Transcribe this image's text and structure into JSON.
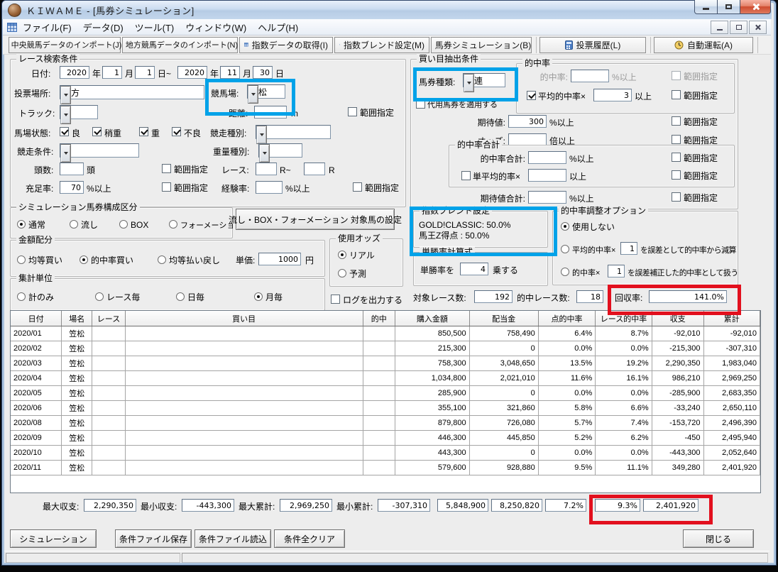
{
  "window": {
    "title": "ＫＩＷＡＭＥ - [馬券シミュレーション]",
    "menu": [
      "ファイル(F)",
      "データ(D)",
      "ツール(T)",
      "ウィンドウ(W)",
      "ヘルプ(H)"
    ]
  },
  "toolbar": {
    "buttons": [
      "中央競馬データのインポート(J)",
      "地方競馬データのインポート(N)",
      "指数データの取得(I)",
      "指数ブレンド設定(M)",
      "馬券シミュレーション(B)",
      "投票履歴(L)",
      "自動運転(A)"
    ]
  },
  "search": {
    "title": "レース検索条件",
    "date_label": "日付:",
    "y1": "2020",
    "m1": "1",
    "d1": "1",
    "y2": "2020",
    "m2": "11",
    "d2": "30",
    "year": "年",
    "month": "月",
    "day": "日",
    "day_tilde": "日~",
    "place_label": "投票場所:",
    "place_value": "地方",
    "course_label": "競馬場:",
    "course_value": "笠松",
    "track_label": "トラック:",
    "distance_label": "距離:",
    "distance_unit": "m",
    "range": "範囲指定",
    "cond_label": "馬場状態:",
    "cond_items": [
      "良",
      "稍重",
      "重",
      "不良"
    ],
    "race_type_label": "競走種別:",
    "race_cond_label": "競走条件:",
    "weight_label": "重量種別:",
    "heads_label": "頭数:",
    "heads_unit": "頭",
    "race_label": "レース:",
    "race_r1": "R~",
    "race_r2": "R",
    "full_label": "充足率:",
    "full_value": "70",
    "pct_min": "%以上",
    "exp_label": "経験率:"
  },
  "ticket": {
    "title": "シミュレーション馬券構成区分",
    "options": [
      "通常",
      "流し",
      "BOX",
      "フォーメーション"
    ],
    "selected": "通常",
    "setting_button": "流し・BOX・フォーメーション 対象馬の設定"
  },
  "amount": {
    "title": "金額配分",
    "options": [
      "均等買い",
      "的中率買い",
      "均等払い戻し"
    ],
    "selected": "的中率買い",
    "unit_label": "単価:",
    "unit_value": "1000",
    "yen": "円"
  },
  "odds_use": {
    "title": "使用オッズ",
    "options": [
      "リアル",
      "予測"
    ],
    "selected": "リアル"
  },
  "agg": {
    "title": "集計単位",
    "options": [
      "計のみ",
      "レース毎",
      "日毎",
      "月毎"
    ],
    "selected": "月毎"
  },
  "log_label": "ログを出力する",
  "extract": {
    "title": "買い目抽出条件",
    "type_label": "馬券種類:",
    "type_value": "枠連",
    "substitute_label": "代用馬券を適用する",
    "hit_group": "的中率",
    "hit_label": "的中率:",
    "avg_hit_label": "平均的中率×",
    "avg_hit_value": "3",
    "ge": "以上",
    "expect_label": "期待値:",
    "expect_value": "300",
    "odds_label": "オッズ:",
    "odds_unit": "倍以上",
    "hit_total_group": "的中率合計",
    "hit_total_label": "的中率合計:",
    "single_avg_label": "単平均的率×",
    "expect_total_label": "期待値合計:",
    "pct_min": "%以上",
    "range": "範囲指定"
  },
  "blend": {
    "title": "指数ブレンド設定",
    "lines": [
      "GOLD!CLASSIC: 50.0%",
      "馬王Z得点 : 50.0%"
    ]
  },
  "win_rate": {
    "title": "単勝率計算式",
    "prefix": "単勝率を",
    "value": "4",
    "suffix": "乗する"
  },
  "adjust": {
    "title": "的中率調整オプション",
    "opt1": "使用しない",
    "opt2_pre": "平均的中率×",
    "opt2_val": "1",
    "opt2_post": "を誤差として的中率から減算",
    "opt3_pre": "的中率×",
    "opt3_val": "1",
    "opt3_post": "を誤差補正した的中率として扱う",
    "selected": "使用しない"
  },
  "stats": {
    "races_label": "対象レース数:",
    "races_value": "192",
    "hits_label": "的中レース数:",
    "hits_value": "18",
    "payback_label": "回収率:",
    "payback_value": "141.0%"
  },
  "table": {
    "headers": [
      "日付",
      "場名",
      "レース",
      "買い目",
      "的中",
      "購入金額",
      "配当金",
      "点的中率",
      "レース的中率",
      "収支",
      "累計"
    ],
    "rows": [
      [
        "2020/01",
        "笠松",
        "",
        "",
        "",
        "850,500",
        "758,490",
        "6.4%",
        "8.7%",
        "-92,010",
        "-92,010"
      ],
      [
        "2020/02",
        "笠松",
        "",
        "",
        "",
        "215,300",
        "0",
        "0.0%",
        "0.0%",
        "-215,300",
        "-307,310"
      ],
      [
        "2020/03",
        "笠松",
        "",
        "",
        "",
        "758,300",
        "3,048,650",
        "13.5%",
        "19.2%",
        "2,290,350",
        "1,983,040"
      ],
      [
        "2020/04",
        "笠松",
        "",
        "",
        "",
        "1,034,800",
        "2,021,010",
        "11.6%",
        "16.1%",
        "986,210",
        "2,969,250"
      ],
      [
        "2020/05",
        "笠松",
        "",
        "",
        "",
        "285,900",
        "0",
        "0.0%",
        "0.0%",
        "-285,900",
        "2,683,350"
      ],
      [
        "2020/06",
        "笠松",
        "",
        "",
        "",
        "355,100",
        "321,860",
        "5.8%",
        "6.6%",
        "-33,240",
        "2,650,110"
      ],
      [
        "2020/08",
        "笠松",
        "",
        "",
        "",
        "879,800",
        "726,080",
        "5.7%",
        "7.4%",
        "-153,720",
        "2,496,390"
      ],
      [
        "2020/09",
        "笠松",
        "",
        "",
        "",
        "446,300",
        "445,850",
        "5.2%",
        "6.2%",
        "-450",
        "2,495,940"
      ],
      [
        "2020/10",
        "笠松",
        "",
        "",
        "",
        "443,300",
        "0",
        "0.0%",
        "0.0%",
        "-443,300",
        "2,052,640"
      ],
      [
        "2020/11",
        "笠松",
        "",
        "",
        "",
        "579,600",
        "928,880",
        "9.5%",
        "11.1%",
        "349,280",
        "2,401,920"
      ]
    ]
  },
  "summary": {
    "items": [
      {
        "label": "最大収支:",
        "value": "2,290,350"
      },
      {
        "label": "最小収支:",
        "value": "-443,300"
      },
      {
        "label": "最大累計:",
        "value": "2,969,250"
      },
      {
        "label": "最小累計:",
        "value": "-307,310"
      }
    ],
    "totals": [
      "5,848,900",
      "8,250,820",
      "7.2%",
      "9.3%",
      "2,401,920"
    ]
  },
  "footer": {
    "buttons": [
      "シミュレーション",
      "条件ファイル保存",
      "条件ファイル読込",
      "条件全クリア"
    ],
    "close": "閉じる"
  },
  "colors": {
    "highlight_blue": "#00A2E8",
    "highlight_red": "#E2101E"
  }
}
